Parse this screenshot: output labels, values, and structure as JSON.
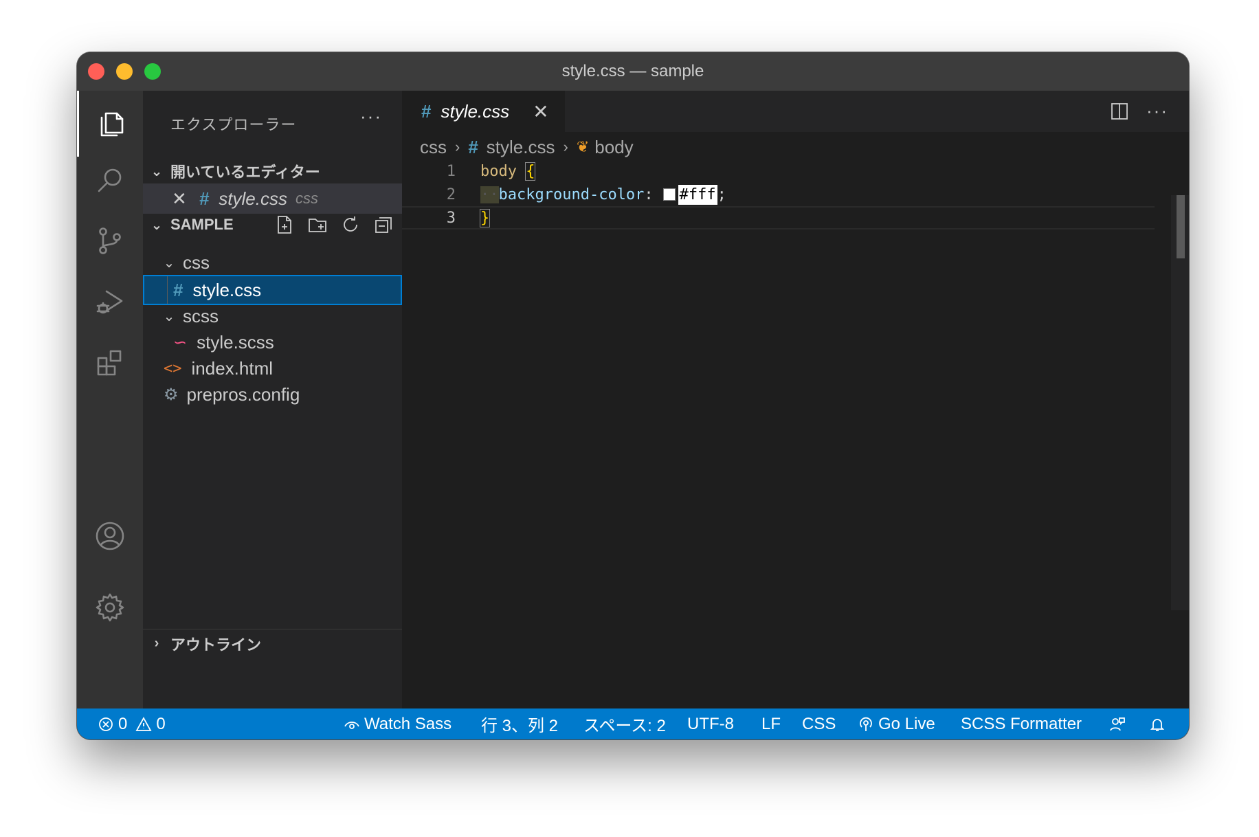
{
  "window": {
    "title": "style.css — sample"
  },
  "sidebar": {
    "title": "エクスプローラー",
    "more": "···",
    "open_editors": {
      "header": "開いているエディター",
      "items": [
        {
          "name": "style.css",
          "folder": "css"
        }
      ]
    },
    "folder": {
      "header": "SAMPLE",
      "tree": [
        {
          "label": "css",
          "type": "folder"
        },
        {
          "label": "style.css",
          "type": "css"
        },
        {
          "label": "scss",
          "type": "folder"
        },
        {
          "label": "style.scss",
          "type": "scss"
        },
        {
          "label": "index.html",
          "type": "html"
        },
        {
          "label": "prepros.config",
          "type": "config"
        }
      ]
    },
    "outline": {
      "header": "アウトライン"
    }
  },
  "editor": {
    "tab": {
      "label": "style.css",
      "icon": "#"
    },
    "breadcrumb": [
      "css",
      "style.css",
      "body"
    ],
    "lines": [
      {
        "number": "1",
        "selector": "body",
        "open": "{"
      },
      {
        "number": "2",
        "property": "background-color",
        "colon": ":",
        "value": "#fff",
        "semi": ";"
      },
      {
        "number": "3",
        "close": "}"
      }
    ]
  },
  "status": {
    "errors": "0",
    "warnings": "0",
    "watch_sass": "Watch Sass",
    "cursor": "行 3、列 2",
    "spaces": "スペース: 2",
    "encoding": "UTF-8",
    "eol": "LF",
    "language": "CSS",
    "go_live": "Go Live",
    "formatter": "SCSS Formatter"
  },
  "colors": {
    "statusbar": "#007acc",
    "selection": "#094771",
    "css_icon": "#519aba"
  }
}
